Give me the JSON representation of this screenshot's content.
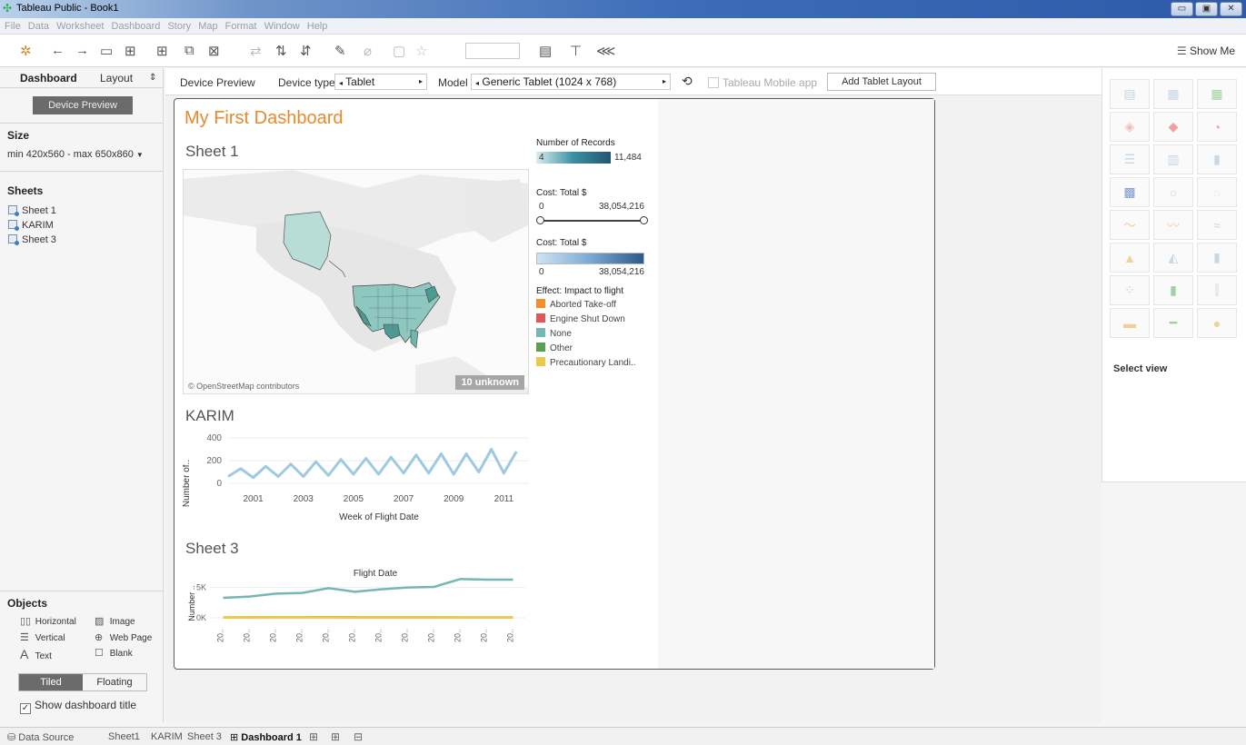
{
  "window": {
    "title": "Tableau Public - Book1",
    "controls": [
      "▭",
      "▣",
      "✕"
    ]
  },
  "menu": [
    "File",
    "Data",
    "Worksheet",
    "Dashboard",
    "Story",
    "Map",
    "Format",
    "Window",
    "Help"
  ],
  "toolbar": {
    "show_me": "Show Me"
  },
  "left_panel": {
    "tabs": [
      "Dashboard",
      "Layout"
    ],
    "device_preview_button": "Device Preview",
    "size_heading": "Size",
    "size_value": "min 420x560 - max 650x860",
    "sheets_heading": "Sheets",
    "sheets": [
      "Sheet 1",
      "KARIM",
      "Sheet 3"
    ],
    "objects_heading": "Objects",
    "objects": [
      "Horizontal",
      "Image",
      "Vertical",
      "Web Page",
      "Text",
      "Blank"
    ],
    "tiled": "Tiled",
    "floating": "Floating",
    "show_title": "Show dashboard title"
  },
  "device_bar": {
    "device_preview": "Device Preview",
    "device_type_label": "Device type",
    "device_type_value": "Tablet",
    "model_label": "Model",
    "model_value": "Generic Tablet (1024 x 768)",
    "mobile_app": "Tableau Mobile app",
    "add_layout": "Add Tablet Layout"
  },
  "dashboard": {
    "title": "My First Dashboard",
    "sheet1_title": "Sheet 1",
    "map_credit": "© OpenStreetMap contributors",
    "unknown_badge": "10 unknown",
    "karim_title": "KARIM",
    "sheet3_title": "Sheet 3"
  },
  "legends": {
    "records_heading": "Number of Records",
    "records_min": "4",
    "records_max": "11,484",
    "cost_filter_heading": "Cost: Total $",
    "cost_filter_min": "0",
    "cost_filter_max": "38,054,216",
    "cost_color_heading": "Cost: Total $",
    "cost_color_min": "0",
    "cost_color_max": "38,054,216",
    "effect_heading": "Effect: Impact to flight",
    "effects": [
      {
        "label": "Aborted Take-off",
        "color": "#f28e2b"
      },
      {
        "label": "Engine Shut Down",
        "color": "#e15759"
      },
      {
        "label": "None",
        "color": "#76b7b2"
      },
      {
        "label": "Other",
        "color": "#59a14f"
      },
      {
        "label": "Precautionary Landi..",
        "color": "#edc948"
      }
    ]
  },
  "show_me": {
    "select_view": "Select view"
  },
  "bottom_tabs": {
    "data_source": "Data Source",
    "sheets": [
      "Sheet1",
      "KARIM",
      "Sheet 3"
    ],
    "active": "Dashboard 1"
  },
  "chart_data": [
    {
      "type": "line",
      "title": "",
      "xlabel": "Week of Flight Date",
      "ylabel": "Number of..",
      "x_ticks": [
        "2001",
        "2003",
        "2005",
        "2007",
        "2009",
        "2011"
      ],
      "y_ticks": [
        "0",
        "200",
        "400"
      ],
      "ylim": [
        0,
        400
      ],
      "series": [
        {
          "color": "#9ecae1",
          "x": [
            2000.0,
            2000.5,
            2001.0,
            2001.5,
            2002.0,
            2002.5,
            2003.0,
            2003.5,
            2004.0,
            2004.5,
            2005.0,
            2005.5,
            2006.0,
            2006.5,
            2007.0,
            2007.5,
            2008.0,
            2008.5,
            2009.0,
            2009.5,
            2010.0,
            2010.5,
            2011.0,
            2011.5
          ],
          "y": [
            60,
            130,
            50,
            150,
            60,
            170,
            60,
            190,
            70,
            210,
            80,
            220,
            80,
            230,
            90,
            250,
            90,
            260,
            80,
            260,
            100,
            300,
            90,
            280
          ]
        }
      ]
    },
    {
      "type": "line",
      "title": "Flight Date",
      "xlabel": "",
      "ylabel": "Number ..",
      "x_ticks": [
        "20..",
        "20..",
        "20..",
        "20..",
        "20..",
        "20..",
        "20..",
        "20..",
        "20..",
        "20..",
        "20..",
        "20.."
      ],
      "y_ticks": [
        "0K",
        "5K"
      ],
      "ylim": [
        0,
        6000
      ],
      "series": [
        {
          "color": "#76b7b2",
          "y": [
            3300,
            3500,
            4000,
            4100,
            4900,
            4300,
            4700,
            5000,
            5100,
            6400,
            6300,
            6300
          ]
        },
        {
          "color": "#f28e2b",
          "y": [
            80,
            90,
            100,
            100,
            110,
            100,
            100,
            90,
            90,
            80,
            80,
            80
          ]
        },
        {
          "color": "#edc948",
          "y": [
            40,
            40,
            50,
            50,
            50,
            40,
            40,
            40,
            40,
            40,
            40,
            40
          ]
        }
      ]
    }
  ]
}
